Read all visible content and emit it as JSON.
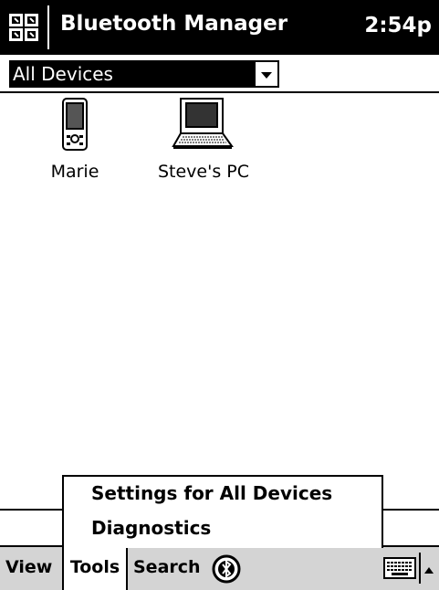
{
  "titlebar": {
    "app_title": "Bluetooth Manager",
    "time": "2:54p",
    "start_icon": "windows-start-flag-icon"
  },
  "filter": {
    "selected": "All Devices",
    "arrow_icon": "chevron-down-icon"
  },
  "devices": [
    {
      "label": "Marie",
      "icon": "pda-icon"
    },
    {
      "label": "Steve's PC",
      "icon": "laptop-icon"
    }
  ],
  "tools_menu": {
    "items": [
      {
        "label": "Settings for All Devices"
      },
      {
        "label": "Diagnostics"
      }
    ]
  },
  "menubar": {
    "view": "View",
    "tools": "Tools",
    "search": "Search",
    "bluetooth_icon": "bluetooth-icon",
    "keyboard_icon": "keyboard-icon",
    "sip_arrow_icon": "chevron-up-icon"
  },
  "colors": {
    "titlebar_bg": "#000000",
    "titlebar_fg": "#ffffff",
    "menubar_bg": "#d4d4d4",
    "content_bg": "#ffffff"
  }
}
